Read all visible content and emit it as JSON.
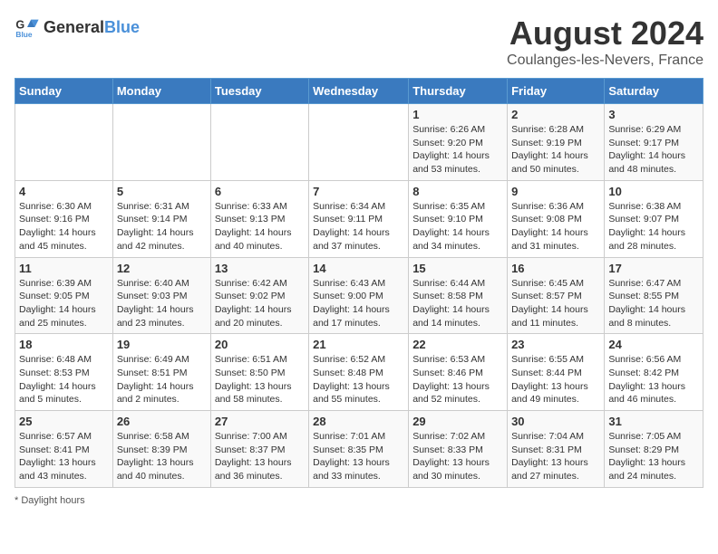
{
  "header": {
    "logo_general": "General",
    "logo_blue": "Blue",
    "title": "August 2024",
    "subtitle": "Coulanges-les-Nevers, France"
  },
  "days_of_week": [
    "Sunday",
    "Monday",
    "Tuesday",
    "Wednesday",
    "Thursday",
    "Friday",
    "Saturday"
  ],
  "weeks": [
    [
      {
        "day": "",
        "info": ""
      },
      {
        "day": "",
        "info": ""
      },
      {
        "day": "",
        "info": ""
      },
      {
        "day": "",
        "info": ""
      },
      {
        "day": "1",
        "info": "Sunrise: 6:26 AM\nSunset: 9:20 PM\nDaylight: 14 hours\nand 53 minutes."
      },
      {
        "day": "2",
        "info": "Sunrise: 6:28 AM\nSunset: 9:19 PM\nDaylight: 14 hours\nand 50 minutes."
      },
      {
        "day": "3",
        "info": "Sunrise: 6:29 AM\nSunset: 9:17 PM\nDaylight: 14 hours\nand 48 minutes."
      }
    ],
    [
      {
        "day": "4",
        "info": "Sunrise: 6:30 AM\nSunset: 9:16 PM\nDaylight: 14 hours\nand 45 minutes."
      },
      {
        "day": "5",
        "info": "Sunrise: 6:31 AM\nSunset: 9:14 PM\nDaylight: 14 hours\nand 42 minutes."
      },
      {
        "day": "6",
        "info": "Sunrise: 6:33 AM\nSunset: 9:13 PM\nDaylight: 14 hours\nand 40 minutes."
      },
      {
        "day": "7",
        "info": "Sunrise: 6:34 AM\nSunset: 9:11 PM\nDaylight: 14 hours\nand 37 minutes."
      },
      {
        "day": "8",
        "info": "Sunrise: 6:35 AM\nSunset: 9:10 PM\nDaylight: 14 hours\nand 34 minutes."
      },
      {
        "day": "9",
        "info": "Sunrise: 6:36 AM\nSunset: 9:08 PM\nDaylight: 14 hours\nand 31 minutes."
      },
      {
        "day": "10",
        "info": "Sunrise: 6:38 AM\nSunset: 9:07 PM\nDaylight: 14 hours\nand 28 minutes."
      }
    ],
    [
      {
        "day": "11",
        "info": "Sunrise: 6:39 AM\nSunset: 9:05 PM\nDaylight: 14 hours\nand 25 minutes."
      },
      {
        "day": "12",
        "info": "Sunrise: 6:40 AM\nSunset: 9:03 PM\nDaylight: 14 hours\nand 23 minutes."
      },
      {
        "day": "13",
        "info": "Sunrise: 6:42 AM\nSunset: 9:02 PM\nDaylight: 14 hours\nand 20 minutes."
      },
      {
        "day": "14",
        "info": "Sunrise: 6:43 AM\nSunset: 9:00 PM\nDaylight: 14 hours\nand 17 minutes."
      },
      {
        "day": "15",
        "info": "Sunrise: 6:44 AM\nSunset: 8:58 PM\nDaylight: 14 hours\nand 14 minutes."
      },
      {
        "day": "16",
        "info": "Sunrise: 6:45 AM\nSunset: 8:57 PM\nDaylight: 14 hours\nand 11 minutes."
      },
      {
        "day": "17",
        "info": "Sunrise: 6:47 AM\nSunset: 8:55 PM\nDaylight: 14 hours\nand 8 minutes."
      }
    ],
    [
      {
        "day": "18",
        "info": "Sunrise: 6:48 AM\nSunset: 8:53 PM\nDaylight: 14 hours\nand 5 minutes."
      },
      {
        "day": "19",
        "info": "Sunrise: 6:49 AM\nSunset: 8:51 PM\nDaylight: 14 hours\nand 2 minutes."
      },
      {
        "day": "20",
        "info": "Sunrise: 6:51 AM\nSunset: 8:50 PM\nDaylight: 13 hours\nand 58 minutes."
      },
      {
        "day": "21",
        "info": "Sunrise: 6:52 AM\nSunset: 8:48 PM\nDaylight: 13 hours\nand 55 minutes."
      },
      {
        "day": "22",
        "info": "Sunrise: 6:53 AM\nSunset: 8:46 PM\nDaylight: 13 hours\nand 52 minutes."
      },
      {
        "day": "23",
        "info": "Sunrise: 6:55 AM\nSunset: 8:44 PM\nDaylight: 13 hours\nand 49 minutes."
      },
      {
        "day": "24",
        "info": "Sunrise: 6:56 AM\nSunset: 8:42 PM\nDaylight: 13 hours\nand 46 minutes."
      }
    ],
    [
      {
        "day": "25",
        "info": "Sunrise: 6:57 AM\nSunset: 8:41 PM\nDaylight: 13 hours\nand 43 minutes."
      },
      {
        "day": "26",
        "info": "Sunrise: 6:58 AM\nSunset: 8:39 PM\nDaylight: 13 hours\nand 40 minutes."
      },
      {
        "day": "27",
        "info": "Sunrise: 7:00 AM\nSunset: 8:37 PM\nDaylight: 13 hours\nand 36 minutes."
      },
      {
        "day": "28",
        "info": "Sunrise: 7:01 AM\nSunset: 8:35 PM\nDaylight: 13 hours\nand 33 minutes."
      },
      {
        "day": "29",
        "info": "Sunrise: 7:02 AM\nSunset: 8:33 PM\nDaylight: 13 hours\nand 30 minutes."
      },
      {
        "day": "30",
        "info": "Sunrise: 7:04 AM\nSunset: 8:31 PM\nDaylight: 13 hours\nand 27 minutes."
      },
      {
        "day": "31",
        "info": "Sunrise: 7:05 AM\nSunset: 8:29 PM\nDaylight: 13 hours\nand 24 minutes."
      }
    ]
  ],
  "footer": {
    "note": "Daylight hours"
  }
}
